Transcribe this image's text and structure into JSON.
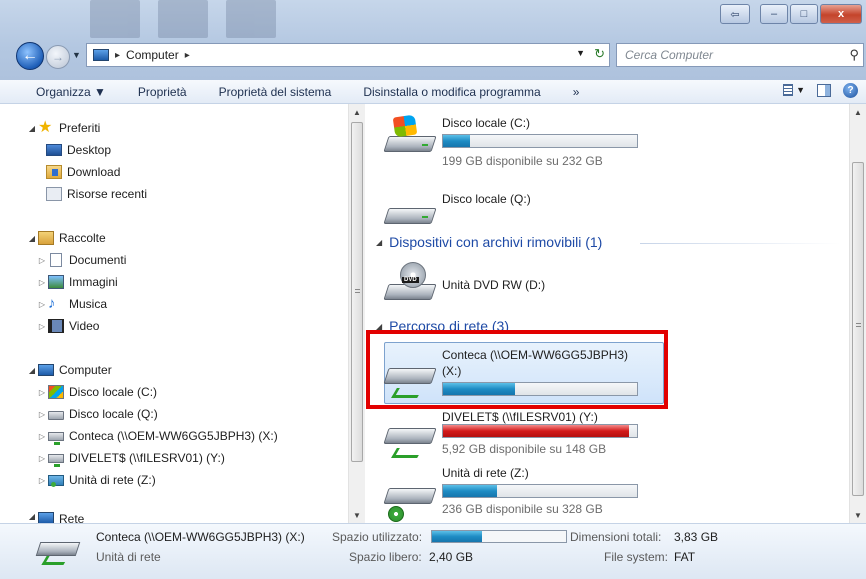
{
  "window": {
    "buttons": {
      "minimize": "–",
      "maximize": "□",
      "close": "x"
    }
  },
  "address": {
    "location": "Computer",
    "search_placeholder": "Cerca Computer"
  },
  "toolbar": {
    "organize": "Organizza ▼",
    "properties": "Proprietà",
    "system_properties": "Proprietà del sistema",
    "uninstall": "Disinstalla o modifica programma",
    "more": "»"
  },
  "nav": {
    "favorites": {
      "label": "Preferiti",
      "items": [
        "Desktop",
        "Download",
        "Risorse recenti"
      ]
    },
    "libraries": {
      "label": "Raccolte",
      "items": [
        "Documenti",
        "Immagini",
        "Musica",
        "Video"
      ]
    },
    "computer": {
      "label": "Computer",
      "items": [
        "Disco locale (C:)",
        "Disco locale (Q:)",
        "Conteca (\\\\OEM-WW6GG5JBPH3) (X:)",
        "DIVELET$ (\\\\fILESRV01) (Y:)",
        "Unità di rete (Z:)"
      ]
    },
    "network_partial": "Rete"
  },
  "content": {
    "drives": [
      {
        "name": "Disco locale (C:)",
        "usage": 0.14,
        "free_text": "199 GB disponibile su 232 GB"
      },
      {
        "name": "Disco locale (Q:)"
      }
    ],
    "removable_header": "Dispositivi con archivi rimovibili (1)",
    "dvd": {
      "name": "Unità DVD RW (D:)"
    },
    "network_header": "Percorso di rete (3)",
    "network": [
      {
        "name_line1": "Conteca (\\\\OEM-WW6GG5JBPH3)",
        "name_line2": "(X:)",
        "usage": 0.37
      },
      {
        "name": "DIVELET$ (\\\\fILESRV01) (Y:)",
        "usage": 0.96,
        "free_text": "5,92 GB disponibile su 148 GB"
      },
      {
        "name": "Unità di rete (Z:)",
        "usage": 0.28,
        "free_text": "236 GB disponibile su 328 GB"
      }
    ]
  },
  "details": {
    "name": "Conteca (\\\\OEM-WW6GG5JBPH3) (X:)",
    "type": "Unità di rete",
    "used_label": "Spazio utilizzato:",
    "used_fraction": 0.37,
    "free_label": "Spazio libero:",
    "free_value": "2,40 GB",
    "total_label": "Dimensioni totali:",
    "total_value": "3,83 GB",
    "fs_label": "File system:",
    "fs_value": "FAT"
  }
}
